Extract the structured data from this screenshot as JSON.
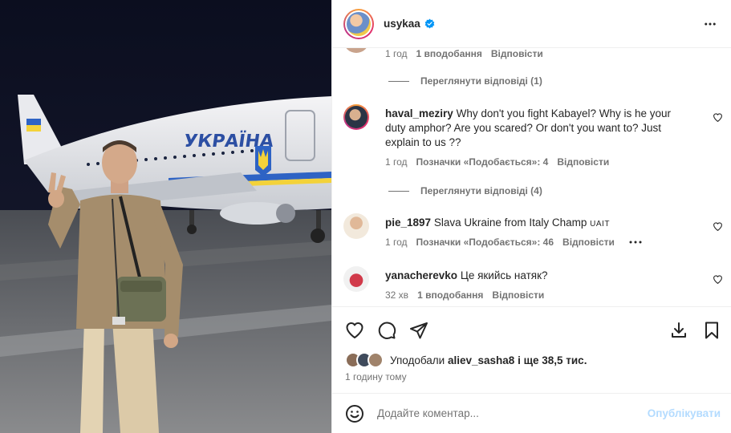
{
  "post": {
    "username": "usykaa",
    "verified": true
  },
  "comments": {
    "partial_top": {
      "time": "1 год",
      "likes": "1 вподобання",
      "reply": "Відповісти"
    },
    "view_replies_1": "Переглянути відповіді (1)",
    "items": [
      {
        "username": "haval_meziry",
        "text": "Why don't you fight Kabayel? Why is he your duty amphor? Are you scared? Or don't you want to? Just explain to us ??",
        "time": "1 год",
        "likes": "Позначки «Подобається»: 4",
        "reply": "Відповісти"
      },
      {
        "username": "pie_1897",
        "text": "Slava Ukraine from Italy Champ",
        "flag": "UAIT",
        "time": "1 год",
        "likes": "Позначки «Подобається»: 46",
        "reply": "Відповісти"
      },
      {
        "username": "yanacherevko",
        "text": "Це якийсь натяк?",
        "time": "32 хв",
        "likes": "1 вподобання",
        "reply": "Відповісти"
      }
    ],
    "view_replies_2": "Переглянути відповіді (4)"
  },
  "likes": {
    "prefix": "Уподобали",
    "user": "aliev_sasha8",
    "suffix": "і ще 38,5 тис."
  },
  "timestamp": "1 годину тому",
  "comment_box": {
    "placeholder": "Додайте коментар...",
    "post_label": "Опублікувати"
  },
  "photo": {
    "plane_text": "УКРАЇНА"
  },
  "icons": {
    "like": "heart-icon",
    "comment": "comment-icon",
    "share": "share-icon",
    "save": "bookmark-icon",
    "download": "download-icon",
    "emoji": "emoji-icon",
    "more": "more-icon"
  },
  "colors": {
    "text": "#262626",
    "secondary": "#737373",
    "verified": "#0095f6",
    "post_disabled": "#b3dbff",
    "divider": "#efefef"
  }
}
